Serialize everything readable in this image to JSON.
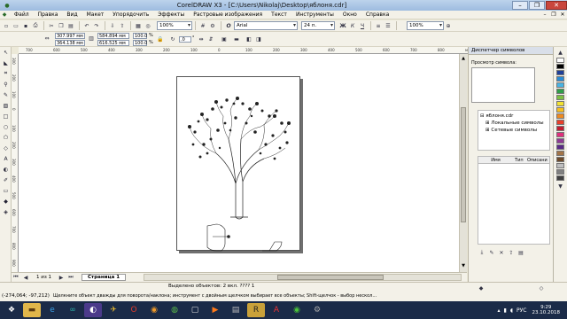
{
  "app_title": "CorelDRAW X3 - [C:\\Users\\Nikolaj\\Desktop\\яблоня.cdr]",
  "window_controls": {
    "minimize": "–",
    "maximize": "❐",
    "close": "✕"
  },
  "menu": [
    "Файл",
    "Правка",
    "Вид",
    "Макет",
    "Упорядочить",
    "Эффекты",
    "Растровые изображения",
    "Текст",
    "Инструменты",
    "Окно",
    "Справка"
  ],
  "mdi_controls": [
    "–",
    "❐",
    "✕"
  ],
  "toolbar": {
    "zoom": "100%",
    "font": "Arial",
    "font_size": "24 п.",
    "zoom2": "100%"
  },
  "propbar": {
    "x": "307.997 мм",
    "y": "364.138 мм",
    "w": "584.894 мм",
    "h": "616.525 мм",
    "sx": "100.0",
    "sy": "100.0",
    "pct": "%",
    "angle": ".0",
    "deg": "°"
  },
  "ruler_top_labels": [
    "700",
    "600",
    "500",
    "400",
    "300",
    "200",
    "100",
    "0",
    "100",
    "200",
    "300",
    "400",
    "500",
    "600",
    "700",
    "800",
    "миллиметры"
  ],
  "ruler_left_labels": [
    "300",
    "200",
    "100",
    "0",
    "100",
    "200",
    "300",
    "400",
    "500",
    "600",
    "700",
    "800",
    "900"
  ],
  "page_nav": {
    "current": "1 из 1",
    "tab": "Страница 1"
  },
  "status": {
    "selection": "Выделено объектов: 2 вкл. ???? 1",
    "coords": "(-274,064; -97,212)",
    "hint": "Щелкните объект дважды для поворота/наклона; инструмент с двойным щелчком выбирает все объекты; Shift-щелчок - выбор нескол..."
  },
  "docker": {
    "title": "Диспетчер символов",
    "preview_label": "Просмотр символа:",
    "tree": [
      "яблоня.cdr",
      "Локальные символы",
      "Сетевые символы"
    ],
    "columns": [
      "Имя",
      "Тип",
      "Описани"
    ]
  },
  "palette_colors": [
    "#ffffff",
    "#000000",
    "#1e3f99",
    "#2a8bd4",
    "#48b4e4",
    "#2f9e4a",
    "#7cc043",
    "#f2e230",
    "#f8c01c",
    "#ef8a1f",
    "#e8402a",
    "#c21d2f",
    "#e0307c",
    "#8e3b93",
    "#5a2a86",
    "#a37447",
    "#6e4b2a",
    "#bfbfbf",
    "#808080",
    "#404040"
  ],
  "taskbar": {
    "lang": "РУС",
    "time": "9:29",
    "date": "23.10.2018"
  }
}
